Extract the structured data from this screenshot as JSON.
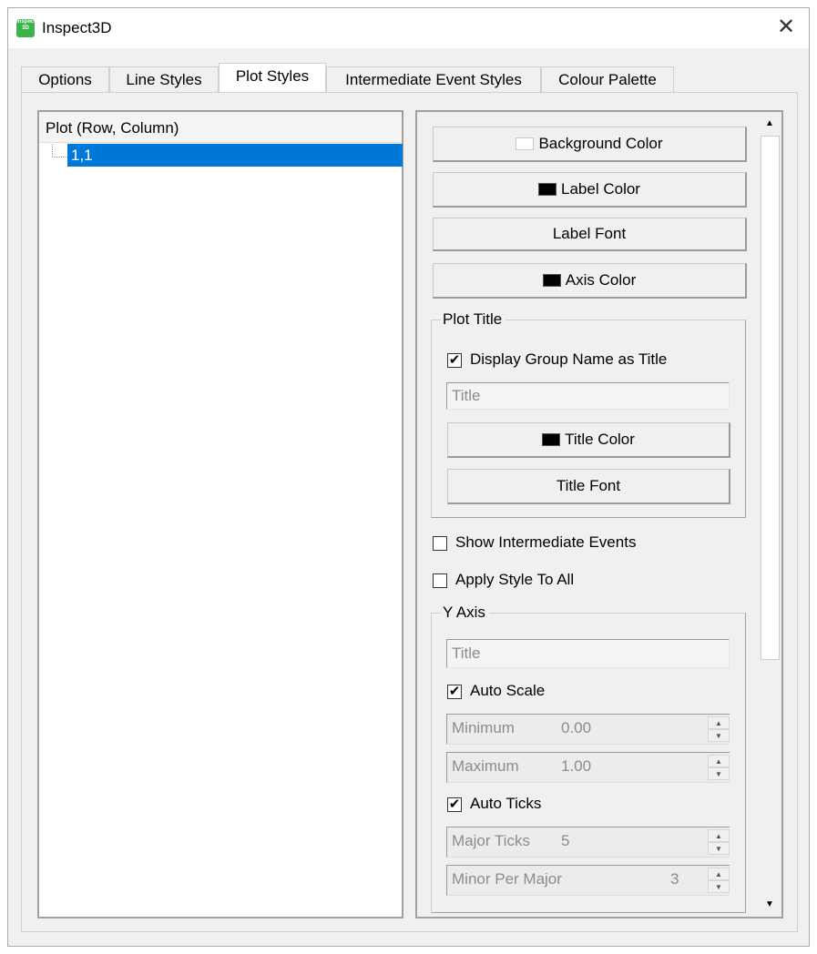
{
  "window": {
    "title": "Inspect3D",
    "icon_text": "Inspect 3D",
    "close_glyph": "✕"
  },
  "tabs": [
    {
      "label": "Options"
    },
    {
      "label": "Line Styles"
    },
    {
      "label": "Plot Styles",
      "active": true
    },
    {
      "label": "Intermediate Event Styles"
    },
    {
      "label": "Colour Palette"
    }
  ],
  "tree": {
    "header": "Plot (Row, Column)",
    "items": [
      {
        "label": "1,1",
        "selected": true
      }
    ]
  },
  "style_buttons": {
    "background_color": "Background Color",
    "label_color": "Label Color",
    "label_font": "Label Font",
    "axis_color": "Axis Color"
  },
  "swatches": {
    "background": "#ffffff",
    "label": "#000000",
    "axis": "#000000",
    "title": "#000000"
  },
  "plot_title": {
    "group_label": "Plot Title",
    "display_group_name": "Display Group Name as Title",
    "display_group_name_checked": true,
    "title_placeholder": "Title",
    "title_color": "Title Color",
    "title_font": "Title Font"
  },
  "options": {
    "show_intermediate_events": "Show Intermediate Events",
    "show_intermediate_events_checked": false,
    "apply_style_to_all": "Apply Style To All",
    "apply_style_to_all_checked": false
  },
  "y_axis": {
    "group_label": "Y Axis",
    "title_placeholder": "Title",
    "auto_scale": "Auto Scale",
    "auto_scale_checked": true,
    "minimum_label": "Minimum",
    "minimum_value": "0.00",
    "maximum_label": "Maximum",
    "maximum_value": "1.00",
    "auto_ticks": "Auto Ticks",
    "auto_ticks_checked": true,
    "major_ticks_label": "Major Ticks",
    "major_ticks_value": "5",
    "minor_per_major_label": "Minor Per Major",
    "minor_per_major_value": "3"
  },
  "glyphs": {
    "check": "✔",
    "spin_up": "▲",
    "spin_down": "▼",
    "scroll_up": "▲",
    "scroll_down": "▼"
  },
  "colors": {
    "accent": "#0078d7",
    "app_icon": "#3cb34a"
  }
}
